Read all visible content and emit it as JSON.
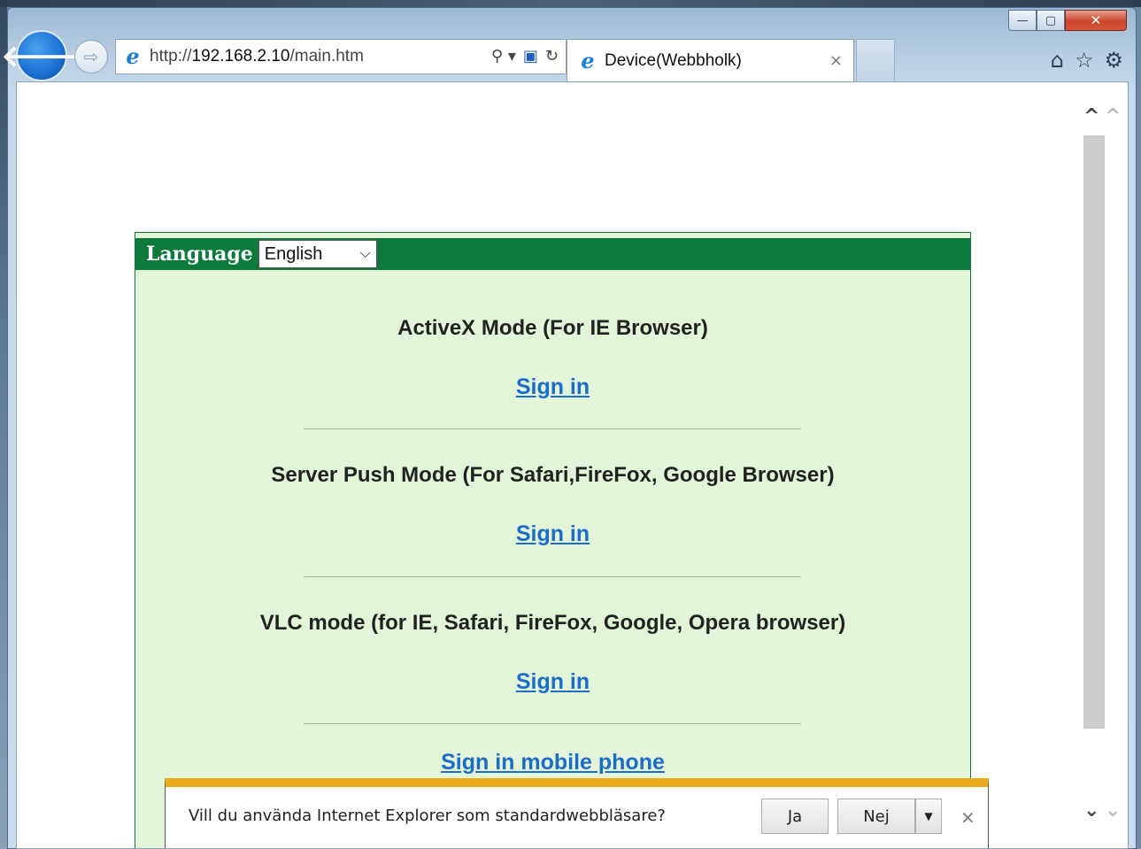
{
  "browser": {
    "url_prefix": "http://",
    "url_host": "192.168.2.10",
    "url_path": "/main.htm",
    "tab_title": "Device(Webbholk)",
    "back_glyph": "🡐",
    "forward_glyph": "⇨",
    "ie_glyph": "e",
    "search_glyph": "⚲ ▾",
    "compat_glyph": "▣",
    "refresh_glyph": "↻",
    "close_tab_glyph": "×",
    "home_glyph": "⌂",
    "favorites_glyph": "☆",
    "tools_glyph": "⚙",
    "minimize_glyph": "—",
    "maximize_glyph": "▢",
    "close_window_glyph": "✕"
  },
  "page": {
    "language_label": "Language",
    "language_selected": "English",
    "language_chevron": "⌵",
    "sections": [
      {
        "title": "ActiveX Mode (For IE Browser)",
        "link": "Sign in"
      },
      {
        "title": "Server Push Mode (For Safari,FireFox, Google Browser)",
        "link": "Sign in"
      },
      {
        "title": "VLC mode (for IE, Safari, FireFox, Google, Opera browser)",
        "link": "Sign in"
      }
    ],
    "mobile_link": "Sign in mobile phone"
  },
  "notification": {
    "text": "Vill du använda Internet Explorer som standardwebbläsare?",
    "yes_label": "Ja",
    "no_label": "Nej",
    "dropdown_glyph": "▼",
    "close_glyph": "×"
  },
  "scroll": {
    "up_glyph": "^",
    "down_glyph": "⌄"
  },
  "colors": {
    "header_green": "#0d7a3b",
    "panel_bg": "#e3f5d9",
    "link_blue": "#1c6cc9",
    "notify_accent": "#e8ac1a"
  }
}
